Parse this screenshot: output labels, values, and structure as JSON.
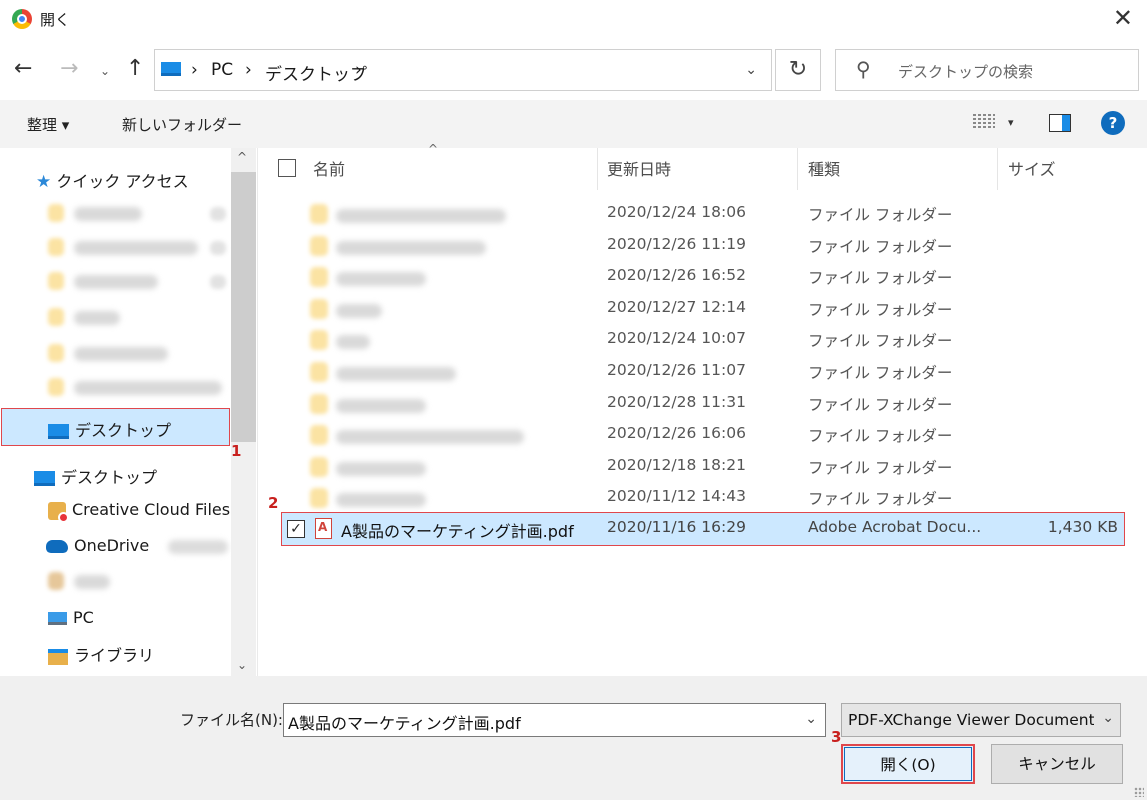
{
  "window": {
    "title": "開く",
    "close_glyph": "✕"
  },
  "nav": {
    "back": "←",
    "forward": "→",
    "recent": "⌄",
    "up": "↑"
  },
  "address": {
    "crumb_sep": "›",
    "path": [
      "PC",
      "デスクトップ"
    ],
    "dropdown": "⌄",
    "refresh": "↻"
  },
  "search": {
    "placeholder": "デスクトップの検索"
  },
  "toolbar": {
    "organize": "整理 ▾",
    "new_folder": "新しいフォルダー",
    "view_dd": "▾",
    "help": "?"
  },
  "sidebar": {
    "quick_access": "クイック アクセス",
    "desktop_quick": "デスクトップ",
    "desktop": "デスクトップ",
    "creative_cloud": "Creative Cloud Files",
    "onedrive": "OneDrive",
    "pc": "PC",
    "library": "ライブラリ",
    "scroll_up": "^",
    "scroll_down": "⌄"
  },
  "columns": {
    "name": "名前",
    "date": "更新日時",
    "type": "種類",
    "size": "サイズ",
    "sort": "^"
  },
  "folders": [
    {
      "date": "2020/12/24 18:06",
      "type": "ファイル フォルダー"
    },
    {
      "date": "2020/12/26 11:19",
      "type": "ファイル フォルダー"
    },
    {
      "date": "2020/12/26 16:52",
      "type": "ファイル フォルダー"
    },
    {
      "date": "2020/12/27 12:14",
      "type": "ファイル フォルダー"
    },
    {
      "date": "2020/12/24 10:07",
      "type": "ファイル フォルダー"
    },
    {
      "date": "2020/12/26 11:07",
      "type": "ファイル フォルダー"
    },
    {
      "date": "2020/12/28 11:31",
      "type": "ファイル フォルダー"
    },
    {
      "date": "2020/12/26 16:06",
      "type": "ファイル フォルダー"
    },
    {
      "date": "2020/12/18 18:21",
      "type": "ファイル フォルダー"
    },
    {
      "date": "2020/11/12 14:43",
      "type": "ファイル フォルダー"
    }
  ],
  "selected_file": {
    "check": "✓",
    "name": "A製品のマーケティング計画.pdf",
    "date": "2020/11/16 16:29",
    "type": "Adobe Acrobat Docu...",
    "size": "1,430 KB"
  },
  "annotations": [
    "1",
    "2",
    "3"
  ],
  "footer": {
    "filename_label": "ファイル名(N):",
    "filename_value": "A製品のマーケティング計画.pdf",
    "filename_dd": "⌄",
    "filetype": "PDF-XChange Viewer Documents",
    "filetype_dd": "⌄",
    "open": "開く(O)",
    "cancel": "キャンセル"
  }
}
